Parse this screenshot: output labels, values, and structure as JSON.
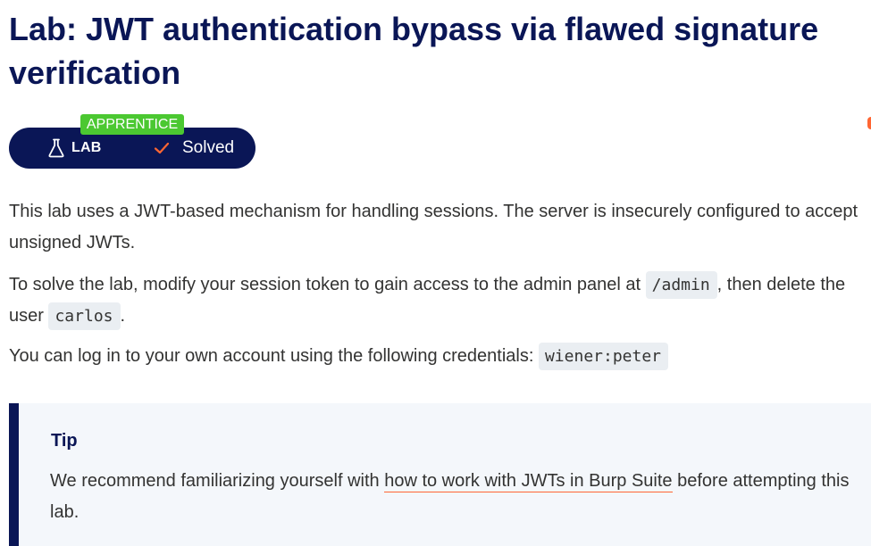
{
  "header": {
    "title_line1": "Lab: JWT authentication bypass via flawed signature",
    "title_line2": "verification"
  },
  "lab_status": {
    "level": "APPRENTICE",
    "type_label": "LAB",
    "status": "Solved"
  },
  "description": {
    "p1": "This lab uses a JWT-based mechanism for handling sessions. The server is insecurely configured to accept unsigned JWTs.",
    "p2_before": "To solve the lab, modify your session token to gain access to the admin panel at ",
    "p2_code1": "/admin",
    "p2_middle": ", then delete the user ",
    "p2_code2": "carlos",
    "p2_after": ".",
    "p3_before": "You can log in to your own account using the following credentials: ",
    "p3_code": "wiener:peter"
  },
  "tip": {
    "title": "Tip",
    "before": "We recommend familiarizing yourself with ",
    "link": "how to work with JWTs in Burp Suite",
    "after": " before attempting this lab."
  },
  "colors": {
    "navy": "#0a1656",
    "apprentice_green": "#4bc831",
    "accent_orange": "#ff6633",
    "code_bg": "#eaeef2",
    "tip_bg": "#f4f7fb",
    "text": "#333332"
  },
  "icons": {
    "lab": "flask-icon",
    "solved": "checkmark-icon"
  }
}
